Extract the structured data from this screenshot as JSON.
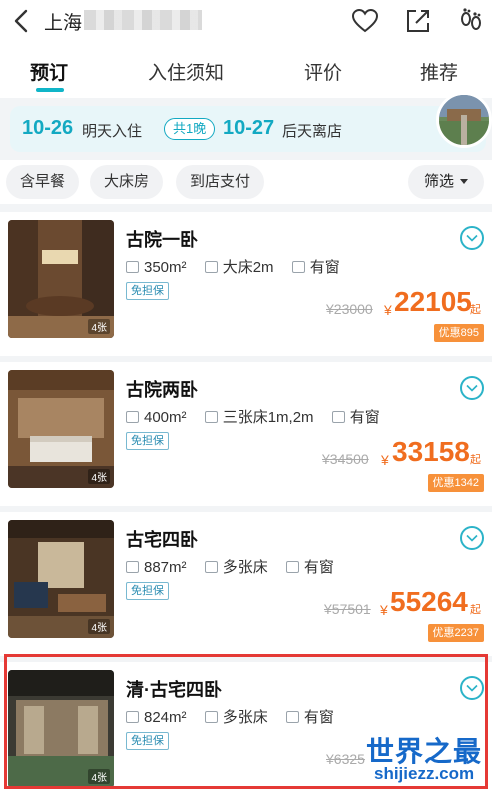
{
  "header": {
    "title": "上海",
    "icons": [
      "back-arrow-icon",
      "heart-icon",
      "share-icon",
      "footprints-icon"
    ]
  },
  "tabs": [
    {
      "label": "预订",
      "active": true
    },
    {
      "label": "入住须知"
    },
    {
      "label": "评价"
    },
    {
      "label": "推荐"
    }
  ],
  "stay": {
    "checkin_date": "10-26",
    "checkin_label": "明天入住",
    "nights": "共1晚",
    "checkout_date": "10-27",
    "checkout_label": "后天离店"
  },
  "filters": {
    "chips": [
      "含早餐",
      "大床房",
      "到店支付"
    ],
    "filter_button": "筛选"
  },
  "rooms": [
    {
      "name": "古院一卧",
      "area": "350m²",
      "bed": "大床2m",
      "window": "有窗",
      "badge": "免担保",
      "original_price": "¥23000",
      "currency": "¥",
      "price": "22105",
      "price_suffix": "起",
      "discount": "优惠895",
      "photo_count": "4张"
    },
    {
      "name": "古院两卧",
      "area": "400m²",
      "bed": "三张床1m,2m",
      "window": "有窗",
      "badge": "免担保",
      "original_price": "¥34500",
      "currency": "¥",
      "price": "33158",
      "price_suffix": "起",
      "discount": "优惠1342",
      "photo_count": "4张"
    },
    {
      "name": "古宅四卧",
      "area": "887m²",
      "bed": "多张床",
      "window": "有窗",
      "badge": "免担保",
      "original_price": "¥57501",
      "currency": "¥",
      "price": "55264",
      "price_suffix": "起",
      "discount": "优惠2237",
      "photo_count": "4张"
    },
    {
      "name": "清·古宅四卧",
      "area": "824m²",
      "bed": "多张床",
      "window": "有窗",
      "badge": "免担保",
      "original_price": "¥6325",
      "photo_count": "4张"
    }
  ],
  "watermark": {
    "line1": "世界之最",
    "line2": "shijiezz.com"
  },
  "colors": {
    "accent": "#13a9c2",
    "price": "#f06d1f",
    "discount_bg": "#f7913a",
    "highlight": "#e53935"
  }
}
